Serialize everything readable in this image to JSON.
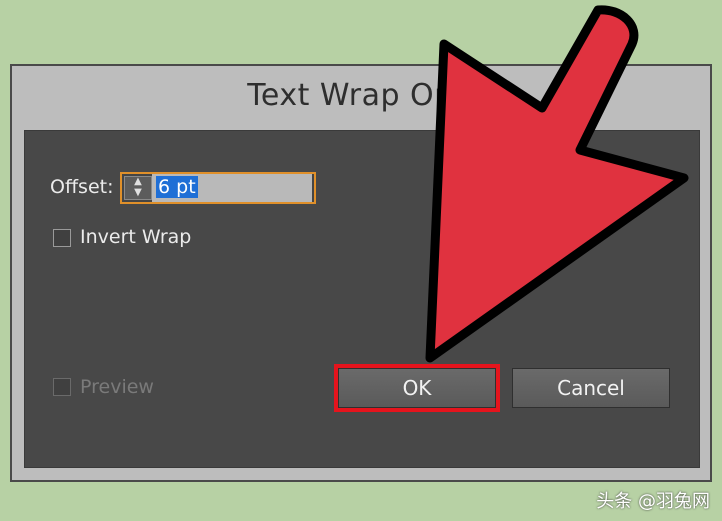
{
  "dialog": {
    "title": "Text Wrap Opti",
    "offset": {
      "label": "Offset:",
      "value": "6 pt"
    },
    "invert_wrap": {
      "label": "Invert Wrap",
      "checked": false
    },
    "preview": {
      "label": "Preview",
      "checked": false,
      "enabled": false
    },
    "buttons": {
      "ok": "OK",
      "cancel": "Cancel"
    }
  },
  "annotation": {
    "arrow_color": "#e0323f",
    "highlight_color": "#e5141d"
  },
  "watermark": "头条 @羽兔网",
  "colors": {
    "background": "#b7d1a4",
    "panel": "#484848",
    "focus_border": "#e0902a",
    "selection": "#1f6fd6"
  }
}
